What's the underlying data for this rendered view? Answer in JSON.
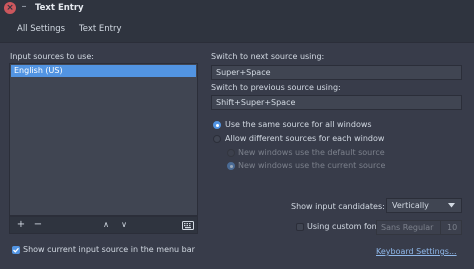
{
  "window": {
    "title": "Text Entry",
    "close_glyph": "×",
    "minimize_glyph": "–"
  },
  "nav": {
    "all_settings": "All Settings",
    "current": "Text Entry"
  },
  "input_sources": {
    "label": "Input sources to use:",
    "items": [
      "English (US)"
    ],
    "toolbar": {
      "add": "+",
      "remove": "−",
      "up": "∧",
      "down": "∨",
      "keyboard_icon": "keyboard-icon"
    }
  },
  "switch": {
    "next_label": "Switch to next source using:",
    "next_value": "Super+Space",
    "prev_label": "Switch to previous source using:",
    "prev_value": "Shift+Super+Space"
  },
  "source_mode": {
    "same_for_all": "Use the same source for all windows",
    "different_each": "Allow different sources for each window",
    "new_default": "New windows use the default source",
    "new_current": "New windows use the current source",
    "selected": "same_for_all",
    "sub_selected": "new_current"
  },
  "menu_bar": {
    "label": "Show current input source in the menu bar",
    "checked": true
  },
  "candidates": {
    "label": "Show input candidates:",
    "value": "Vertically"
  },
  "custom_font": {
    "label": "Using custom font:",
    "checked": false,
    "font_name": "Sans Regular",
    "font_size": "10"
  },
  "keyboard_settings": {
    "label": "Keyboard Settings..."
  },
  "colors": {
    "accent": "#5294e2",
    "window_bg": "#383c4a",
    "header_bg": "#2f343f",
    "close_red": "#cc575d"
  }
}
